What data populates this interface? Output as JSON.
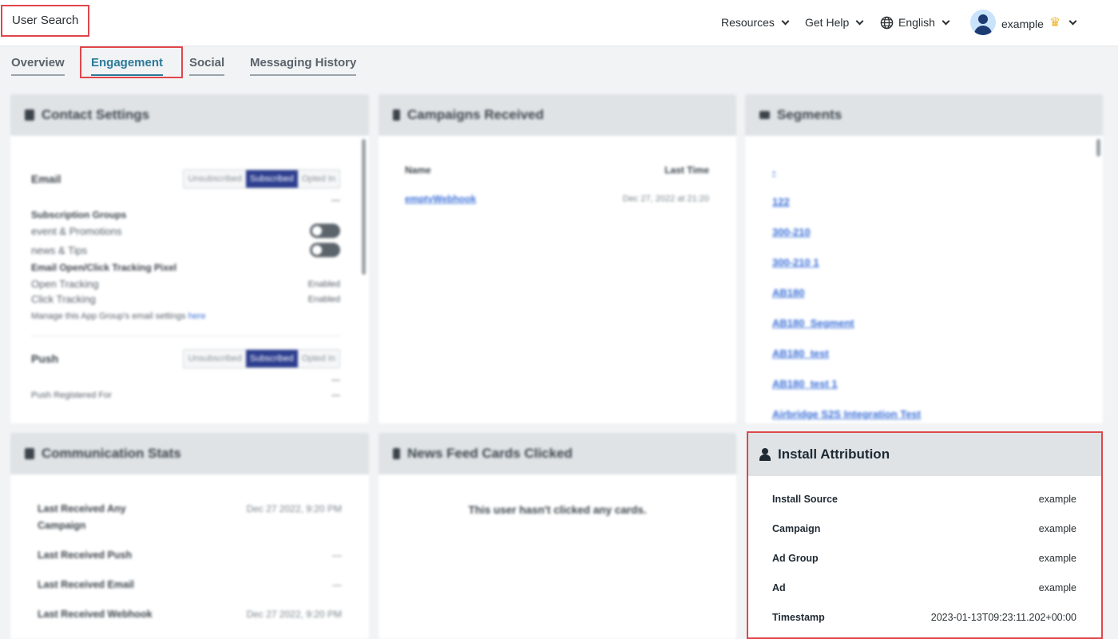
{
  "header": {
    "page_title": "User Search",
    "nav": {
      "resources": "Resources",
      "get_help": "Get Help",
      "language": "English",
      "username": "example"
    },
    "icons": [
      "globe-icon",
      "avatar-icon",
      "crown-icon",
      "chevron-down-icon"
    ]
  },
  "tabs": [
    {
      "label": "Overview"
    },
    {
      "label": "Engagement",
      "active": true
    },
    {
      "label": "Social"
    },
    {
      "label": "Messaging History"
    }
  ],
  "contact_settings": {
    "title": "Contact Settings",
    "email": {
      "label": "Email",
      "options": [
        "Unsubscribed",
        "Subscribed",
        "Opted In"
      ],
      "selected": "Subscribed",
      "value": "—"
    },
    "subscription_groups_label": "Subscription Groups",
    "groups": [
      {
        "name": "event & Promotions",
        "enabled": false
      },
      {
        "name": "news & Tips",
        "enabled": false
      }
    ],
    "tracking_pixel_label": "Email Open/Click Tracking Pixel",
    "open_tracking": {
      "label": "Open Tracking",
      "value": "Enabled"
    },
    "click_tracking": {
      "label": "Click Tracking",
      "value": "Enabled"
    },
    "manage_text": "Manage this App Group's email settings",
    "manage_link": "here",
    "push": {
      "label": "Push",
      "options": [
        "Unsubscribed",
        "Subscribed",
        "Opted In"
      ],
      "selected": "Subscribed",
      "value": "—"
    },
    "push_registered_label": "Push Registered For",
    "push_registered_value": "—"
  },
  "campaigns_received": {
    "title": "Campaigns Received",
    "columns": {
      "name": "Name",
      "last_time": "Last Time"
    },
    "rows": [
      {
        "name": "emptyWebhook",
        "last_time": "Dec 27, 2022 at 21:20"
      }
    ]
  },
  "segments": {
    "title": "Segments",
    "items": [
      "-",
      "122",
      "300-210",
      "300-210 1",
      "AB180",
      "AB180_Segment",
      "AB180_test",
      "AB180_test 1",
      "Airbridge S2S Integration Test"
    ]
  },
  "communication_stats": {
    "title": "Communication Stats",
    "rows": [
      {
        "label": "Last Received Any Campaign",
        "value": "Dec 27 2022, 9:20 PM"
      },
      {
        "label": "Last Received Push",
        "value": "—"
      },
      {
        "label": "Last Received Email",
        "value": "—"
      },
      {
        "label": "Last Received Webhook",
        "value": "Dec 27 2022, 9:20 PM"
      }
    ]
  },
  "news_feed": {
    "title": "News Feed Cards Clicked",
    "empty_text": "This user hasn't clicked any cards."
  },
  "install_attribution": {
    "title": "Install Attribution",
    "rows": [
      {
        "label": "Install Source",
        "value": "example"
      },
      {
        "label": "Campaign",
        "value": "example"
      },
      {
        "label": "Ad Group",
        "value": "example"
      },
      {
        "label": "Ad",
        "value": "example"
      },
      {
        "label": "Timestamp",
        "value": "2023-01-13T09:23:11.202+00:00"
      }
    ]
  },
  "colors": {
    "highlight": "#e0464b",
    "active_tab": "#2b7a99",
    "subscribed_bg": "#2d3e8f",
    "link": "#3a6fd8",
    "panel_header": "#dfe3e6"
  }
}
